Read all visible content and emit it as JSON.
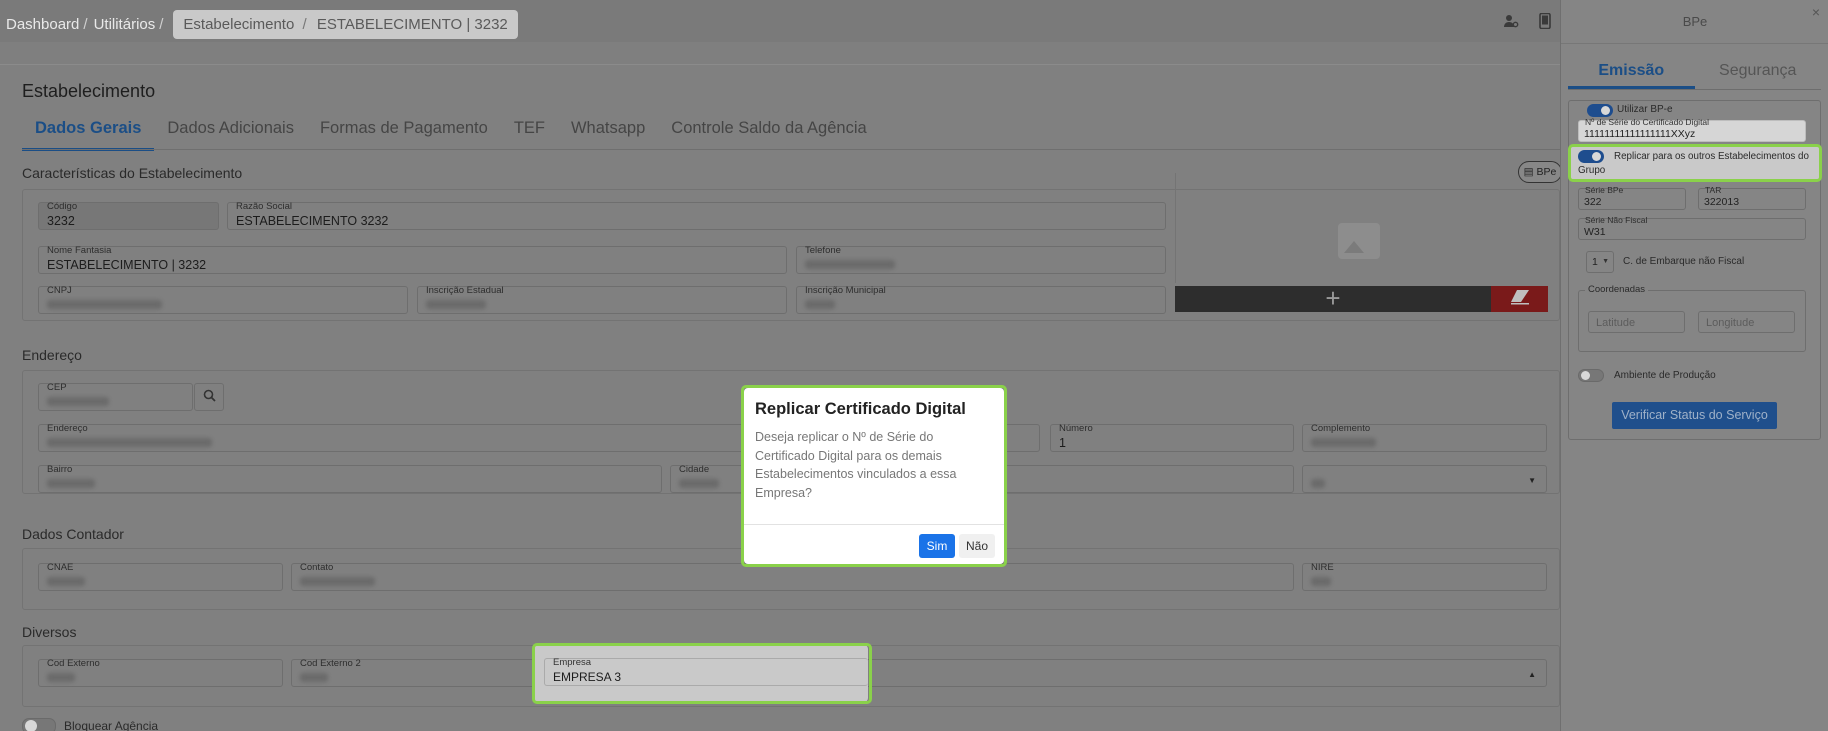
{
  "breadcrumb": {
    "items": [
      "Dashboard",
      "Utilitários"
    ],
    "current_parent": "Estabelecimento",
    "current": "ESTABELECIMENTO | 3232",
    "separator": "/"
  },
  "page": {
    "title": "Estabelecimento",
    "tabs": [
      "Dados Gerais",
      "Dados Adicionais",
      "Formas de Pagamento",
      "TEF",
      "Whatsapp",
      "Controle Saldo da Agência"
    ],
    "active_tab": "Dados Gerais"
  },
  "caracteristicas": {
    "title": "Características do Estabelecimento",
    "bpe_button": "BPe",
    "codigo_label": "Código",
    "codigo_value": "3232",
    "razao_label": "Razão Social",
    "razao_value": "ESTABELECIMENTO 3232",
    "fantasia_label": "Nome Fantasia",
    "fantasia_value": "ESTABELECIMENTO | 3232",
    "telefone_label": "Telefone",
    "cnpj_label": "CNPJ",
    "ie_label": "Inscrição Estadual",
    "im_label": "Inscrição Municipal",
    "add_icon": "+"
  },
  "endereco": {
    "title": "Endereço",
    "cep_label": "CEP",
    "endereco_label": "Endereço",
    "numero_label": "Número",
    "numero_value": "1",
    "complemento_label": "Complemento",
    "bairro_label": "Bairro",
    "cidade_label": "Cidade"
  },
  "contador": {
    "title": "Dados Contador",
    "cnae_label": "CNAE",
    "contato_label": "Contato",
    "nire_label": "NIRE"
  },
  "diversos": {
    "title": "Diversos",
    "cod_externo_label": "Cod Externo",
    "cod_externo2_label": "Cod Externo 2",
    "empresa_label": "Empresa",
    "empresa_value": "EMPRESA 3",
    "bloquear_label": "Bloquear Agência"
  },
  "bpe_panel": {
    "title": "BPe",
    "close": "×",
    "tabs": [
      "Emissão",
      "Segurança"
    ],
    "active_tab": "Emissão",
    "utilizar_label": "Utilizar BP-e",
    "serie_cert_label": "Nº de Série do Certificado Digital",
    "serie_cert_value": "11111111111111111XXyz",
    "replicar_label": "Replicar para os outros Estabelecimentos do Grupo",
    "serie_bpe_label": "Série BPe",
    "serie_bpe_value": "322",
    "tar_label": "TAR",
    "tar_value": "322013",
    "serie_nf_label": "Série Não Fiscal",
    "serie_nf_value": "W31",
    "embarque_select": "1",
    "embarque_label": "C. de Embarque não Fiscal",
    "coordenadas_label": "Coordenadas",
    "latitude_placeholder": "Latitude",
    "longitude_placeholder": "Longitude",
    "ambiente_label": "Ambiente de Produção",
    "verify_button": "Verificar Status do Serviço"
  },
  "modal": {
    "title": "Replicar Certificado Digital",
    "body": "Deseja replicar o Nº de Série do Certificado Digital para os demais Estabelecimentos vinculados a essa Empresa?",
    "yes": "Sim",
    "no": "Não"
  },
  "colors": {
    "highlight": "#8ad14a",
    "primary": "#1a73e8",
    "tab_active": "#1b4e86"
  }
}
